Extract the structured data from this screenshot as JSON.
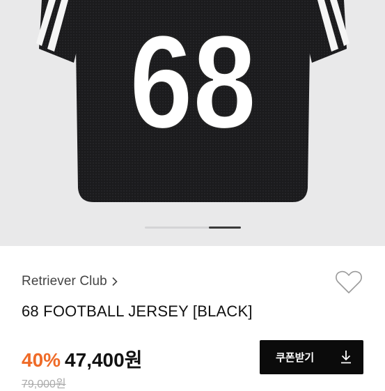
{
  "gallery": {
    "jersey_number": "68",
    "page_indicator": {
      "count": 3,
      "active_index": 2
    }
  },
  "product": {
    "brand": "Retriever Club",
    "name": "68 FOOTBALL JERSEY [BLACK]",
    "discount": "40%",
    "price": "47,400원",
    "original_price": "79,000원"
  },
  "actions": {
    "coupon_label": "쿠폰받기"
  },
  "icons": {
    "brand_link": "chevron-right-icon",
    "wishlist": "heart-outline-icon",
    "coupon": "download-icon"
  },
  "colors": {
    "accent_discount": "#ef6b28",
    "button_bg": "#0b0b0b",
    "gallery_bg": "#e9e9ea"
  }
}
